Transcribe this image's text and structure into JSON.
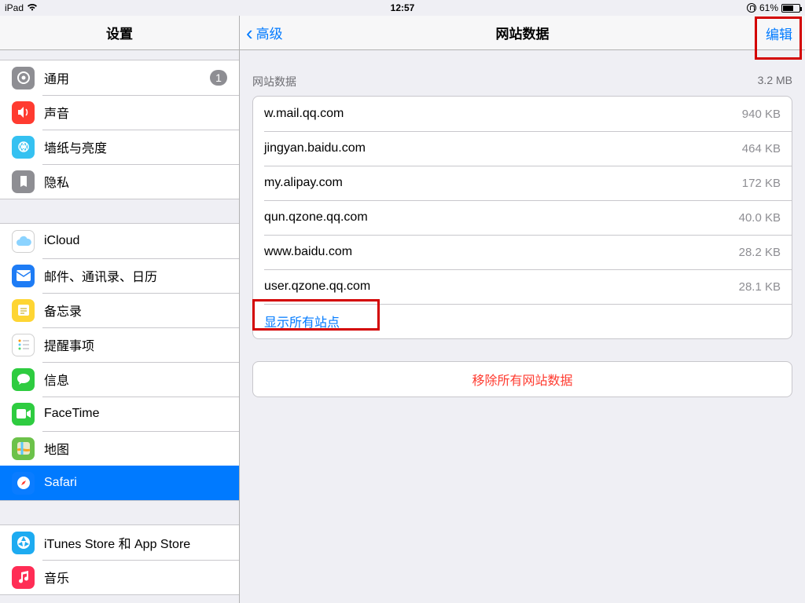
{
  "status": {
    "device": "iPad",
    "time": "12:57",
    "battery_pct": "61%"
  },
  "sidebar": {
    "title": "设置",
    "groups": [
      [
        {
          "key": "general",
          "label": "通用",
          "color": "#8e8e93",
          "badge": "1"
        },
        {
          "key": "sounds",
          "label": "声音",
          "color": "#ff3b30"
        },
        {
          "key": "wallpaper",
          "label": "墙纸与亮度",
          "color": "#35c1f1"
        },
        {
          "key": "privacy",
          "label": "隐私",
          "color": "#8e8e93"
        }
      ],
      [
        {
          "key": "icloud",
          "label": "iCloud",
          "color": "#ffffff",
          "text_color": "#4593e6"
        },
        {
          "key": "mail",
          "label": "邮件、通讯录、日历",
          "color": "#1e7cf5"
        },
        {
          "key": "notes",
          "label": "备忘录",
          "color": "#fed533"
        },
        {
          "key": "reminders",
          "label": "提醒事项",
          "color": "#ffffff"
        },
        {
          "key": "messages",
          "label": "信息",
          "color": "#2ecc40"
        },
        {
          "key": "facetime",
          "label": "FaceTime",
          "color": "#2ecc40"
        },
        {
          "key": "maps",
          "label": "地图",
          "color": "#6cc24a"
        },
        {
          "key": "safari",
          "label": "Safari",
          "color": "#0a7cff",
          "selected": true
        }
      ],
      [
        {
          "key": "itunes",
          "label": "iTunes Store 和 App Store",
          "color": "#1dabf1"
        },
        {
          "key": "music",
          "label": "音乐",
          "color": "#ff2d55"
        }
      ]
    ]
  },
  "detail": {
    "back_label": "高级",
    "title": "网站数据",
    "edit_label": "编辑",
    "section_label": "网站数据",
    "total_size": "3.2 MB",
    "sites": [
      {
        "domain": "w.mail.qq.com",
        "size": "940 KB"
      },
      {
        "domain": "jingyan.baidu.com",
        "size": "464 KB"
      },
      {
        "domain": "my.alipay.com",
        "size": "172 KB"
      },
      {
        "domain": "qun.qzone.qq.com",
        "size": "40.0 KB"
      },
      {
        "domain": "www.baidu.com",
        "size": "28.2 KB"
      },
      {
        "domain": "user.qzone.qq.com",
        "size": "28.1 KB"
      }
    ],
    "show_all_label": "显示所有站点",
    "remove_all_label": "移除所有网站数据"
  }
}
